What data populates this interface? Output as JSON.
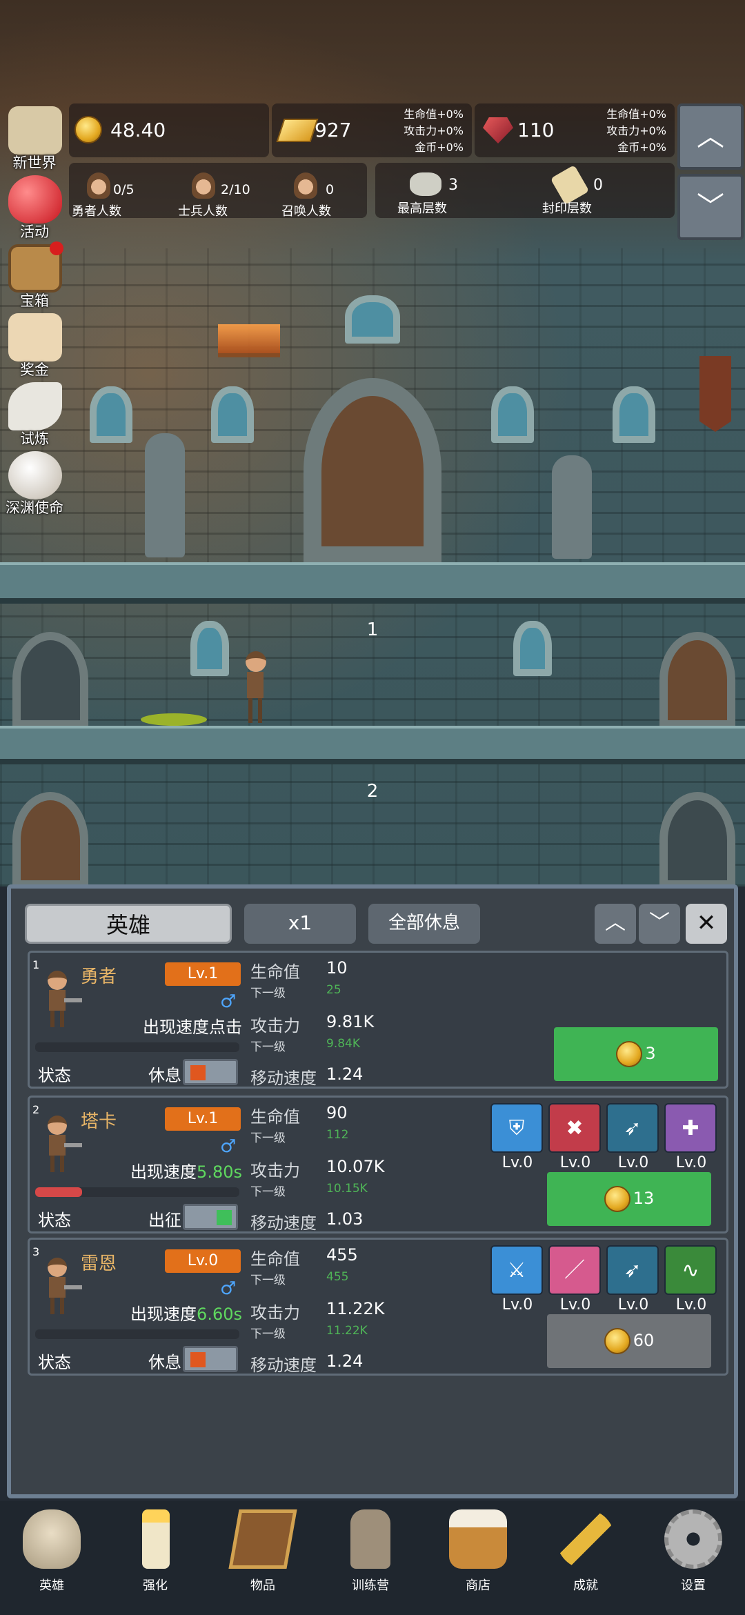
{
  "resources": {
    "gold": "48.40",
    "gold_bar": "927",
    "gem": "110",
    "bonus_lines": [
      "生命值+0%",
      "攻击力+0%",
      "金币+0%"
    ]
  },
  "counts": [
    {
      "value": "0/5",
      "label": "勇者人数"
    },
    {
      "value": "2/10",
      "label": "士兵人数"
    },
    {
      "value": "0",
      "label": "召唤人数"
    },
    {
      "value": "3",
      "label": "最高层数"
    },
    {
      "value": "0",
      "label": "封印层数"
    }
  ],
  "side_menu": [
    "新世界",
    "活动",
    "宝箱",
    "奖金",
    "试炼",
    "深渊使命"
  ],
  "floors": [
    "1",
    "2"
  ],
  "panel": {
    "tab_title": "英雄",
    "speed_label": "x1",
    "rest_all_label": "全部休息"
  },
  "heroes": [
    {
      "no": "1",
      "name": "勇者",
      "level": "Lv.1",
      "gender": "♂",
      "speed_prefix": "出现速度点击",
      "speed_value": "",
      "state_label": "状态",
      "state": "休息",
      "active": false,
      "progress": 0,
      "hp": "10",
      "hp_next": "25",
      "atk": "9.81K",
      "atk_next": "9.84K",
      "move": "1.24",
      "skills": [],
      "cost": "3",
      "cost_enabled": true
    },
    {
      "no": "2",
      "name": "塔卡",
      "level": "Lv.1",
      "gender": "♂",
      "speed_prefix": "出现速度",
      "speed_value": "5.80s",
      "state_label": "状态",
      "state": "出征",
      "active": true,
      "progress": 0.23,
      "hp": "90",
      "hp_next": "112",
      "atk": "10.07K",
      "atk_next": "10.15K",
      "move": "1.03",
      "skills": [
        "Lv.0",
        "Lv.0",
        "Lv.0",
        "Lv.0"
      ],
      "cost": "13",
      "cost_enabled": true
    },
    {
      "no": "3",
      "name": "雷恩",
      "level": "Lv.0",
      "gender": "♂",
      "speed_prefix": "出现速度",
      "speed_value": "6.60s",
      "state_label": "状态",
      "state": "休息",
      "active": false,
      "progress": 0,
      "hp": "455",
      "hp_next": "455",
      "atk": "11.22K",
      "atk_next": "11.22K",
      "move": "1.24",
      "skills": [
        "Lv.0",
        "Lv.0",
        "Lv.0",
        "Lv.0"
      ],
      "cost": "60",
      "cost_enabled": false
    }
  ],
  "stat_labels": {
    "hp": "生命值",
    "next": "下一级",
    "atk": "攻击力",
    "move": "移动速度"
  },
  "tabs": [
    "英雄",
    "强化",
    "物品",
    "训练营",
    "商店",
    "成就",
    "设置"
  ],
  "colors": {
    "level_badge": "#e2701a",
    "upgrade_green": "#3fb454",
    "disabled_gray": "#6f7377",
    "speed_green": "#5fd85f"
  }
}
